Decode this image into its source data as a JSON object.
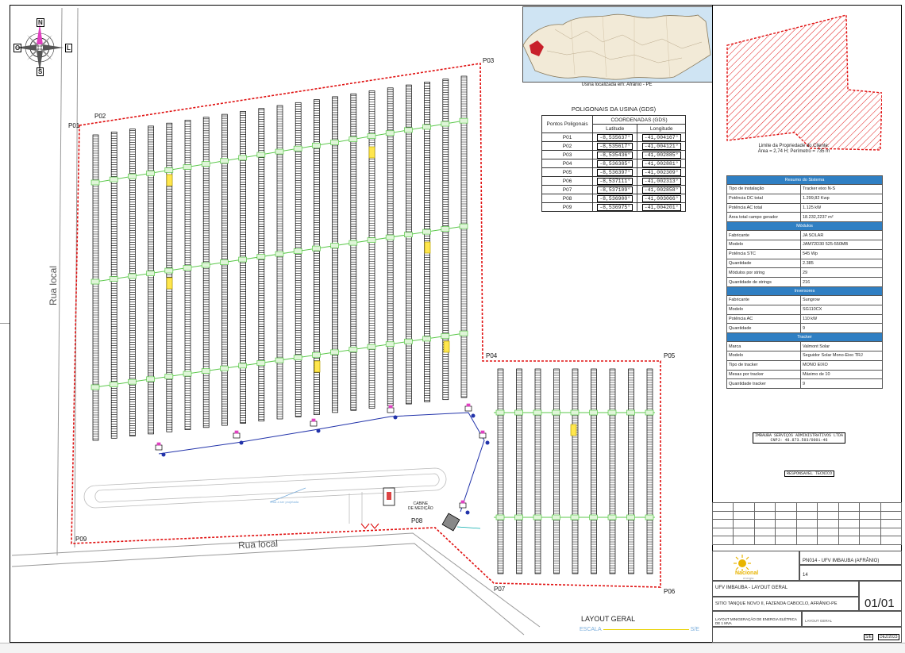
{
  "compass": {
    "north": "N",
    "south": "S",
    "east": "L",
    "west": "O"
  },
  "roads": {
    "vertical": "Rua local",
    "horizontal": "Rua local"
  },
  "points": [
    {
      "id": "P01"
    },
    {
      "id": "P02"
    },
    {
      "id": "P03"
    },
    {
      "id": "P04"
    },
    {
      "id": "P05"
    },
    {
      "id": "P06"
    },
    {
      "id": "P07"
    },
    {
      "id": "P08"
    },
    {
      "id": "P09"
    }
  ],
  "cabin_label": [
    "CABINE",
    "DE MEDIÇÃO"
  ],
  "road_note": "Rua a ser projetada",
  "inset_caption": "Usina localizada em: Afrânio - PE",
  "coords": {
    "title": "POLIGONAIS DA USINA (GDS)",
    "head_points": "Pontos Poligonais",
    "head_coords": "COORDENADAS (GDS)",
    "head_lat": "Latitude",
    "head_lon": "Longitude",
    "rows": [
      {
        "p": "P01",
        "lat": "-8,535637°",
        "lon": "-41,004167°"
      },
      {
        "p": "P02",
        "lat": "-8,535617°",
        "lon": "-41,004121°"
      },
      {
        "p": "P03",
        "lat": "-8,535436°",
        "lon": "-41,002885°"
      },
      {
        "p": "P04",
        "lat": "-8,536385°",
        "lon": "-41,002881°"
      },
      {
        "p": "P05",
        "lat": "-8,536397°",
        "lon": "-41,002309°"
      },
      {
        "p": "P06",
        "lat": "-8,537111°",
        "lon": "-41,002313°"
      },
      {
        "p": "P07",
        "lat": "-8,537109°",
        "lon": "-41,002858°"
      },
      {
        "p": "P08",
        "lat": "-8,536900°",
        "lon": "-41,003066°"
      },
      {
        "p": "P09",
        "lat": "-8,536975°",
        "lon": "-41,004201°"
      }
    ]
  },
  "site_caption": [
    "Limite da Propriedade do Cliente:",
    "Área = 2,74 H; Perímetro = 735 m"
  ],
  "system": {
    "sections": [
      {
        "title": "Resumo do Sistema",
        "rows": [
          [
            "Tipo de instalação",
            "Tracker eixo N-S"
          ],
          [
            "Potência DC total",
            "1.299,82 Kwp"
          ],
          [
            "Potência AC total",
            "1.125 kW"
          ],
          [
            "Área total campo gerador",
            "18.232,2237 m²"
          ]
        ]
      },
      {
        "title": "Módulos",
        "rows": [
          [
            "Fabricante",
            "JA SOLAR"
          ],
          [
            "Modelo",
            "JAM72D30 525-550MB"
          ],
          [
            "Potência STC",
            "545 Wp"
          ],
          [
            "Quantidade",
            "2.385"
          ],
          [
            "Módulos por string",
            "29"
          ],
          [
            "Quantidade de strings",
            "216"
          ]
        ]
      },
      {
        "title": "Inversores",
        "rows": [
          [
            "Fabricante",
            "Sungrow"
          ],
          [
            "Modelo",
            "SG110CX"
          ],
          [
            "Potência AC",
            "110 kW"
          ],
          [
            "Quantidade",
            "9"
          ]
        ]
      },
      {
        "title": "Tracker",
        "rows": [
          [
            "Marca",
            "Valmont Solar"
          ],
          [
            "Modelo",
            "Seguidor Solar Mono-Eixo TRJ"
          ],
          [
            "Tipo de tracker",
            "MONO EIXO"
          ],
          [
            "Mesas por tracker",
            "Máximo de 10"
          ],
          [
            "Quantidade tracker",
            "9"
          ]
        ]
      }
    ]
  },
  "stamps": {
    "company": "IMBAÚBA SERVIÇOS ADMINISTRATIVOS LTDA",
    "cnpj": "CNPJ: 48.873.593/0001-46",
    "tech": "RESPONSÁVEL TÉCNICO"
  },
  "title_block": {
    "logo_text": "Nacional",
    "logo_sub": "energia",
    "project_code": "PN014 - UFV IMBAUBA (AFRÂNIO)",
    "project_num": "14",
    "drawing": "UFV IMBAUBA - LAYOUT GERAL",
    "address": "SITIO TANQUE NOVO II, FAZENDA CABOCLO, AFRÂNIO-PE",
    "sheet": "01/01",
    "desc": "LAYOUT MINIGERAÇÃO DE ENERGIA ELÉTRICA DE 1 MVA",
    "type": "LAYOUT GERAL",
    "date": "DEZ/2023",
    "scale_mark": "S/E"
  },
  "layout_title": "LAYOUT GERAL",
  "escala": {
    "label": "ESCALA",
    "value": "S/E"
  }
}
